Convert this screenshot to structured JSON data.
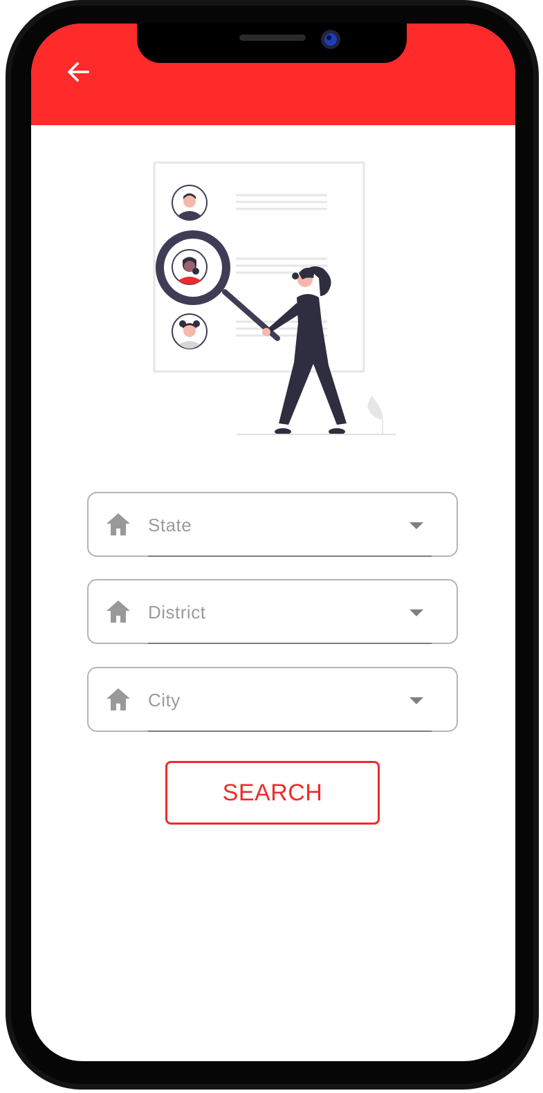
{
  "header": {
    "back_icon": "arrow-left-icon",
    "background_color": "#ff2a2a"
  },
  "form": {
    "fields": [
      {
        "icon": "home-icon",
        "label": "State"
      },
      {
        "icon": "home-icon",
        "label": "District"
      },
      {
        "icon": "home-icon",
        "label": "City"
      }
    ],
    "search_label": "SEARCH",
    "accent_color": "#ee2b2b"
  }
}
